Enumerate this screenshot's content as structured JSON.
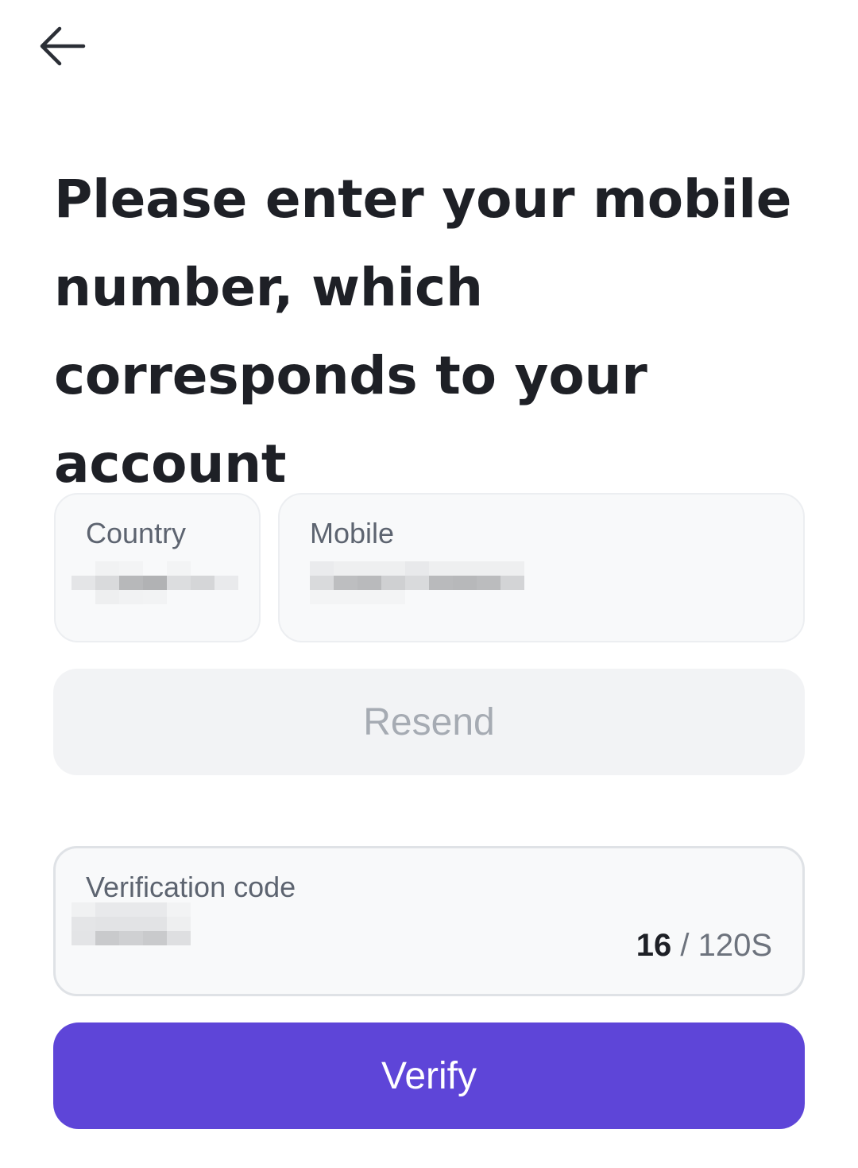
{
  "nav": {
    "back_icon": "arrow-left-icon"
  },
  "headline": "Please enter your mobile number, which corresponds to your account",
  "country_field": {
    "label": "Country"
  },
  "mobile_field": {
    "label": "Mobile"
  },
  "resend": {
    "label": "Resend"
  },
  "verification_field": {
    "label": "Verification code",
    "timer_current": "16",
    "timer_separator": "/",
    "timer_total": "120S"
  },
  "verify": {
    "label": "Verify"
  },
  "colors": {
    "accent": "#5e45d8",
    "text_primary": "#1e2026",
    "text_secondary": "#5d6470",
    "field_bg": "#f8f9fa",
    "disabled_bg": "#f2f3f5",
    "disabled_text": "#a6abb3"
  }
}
